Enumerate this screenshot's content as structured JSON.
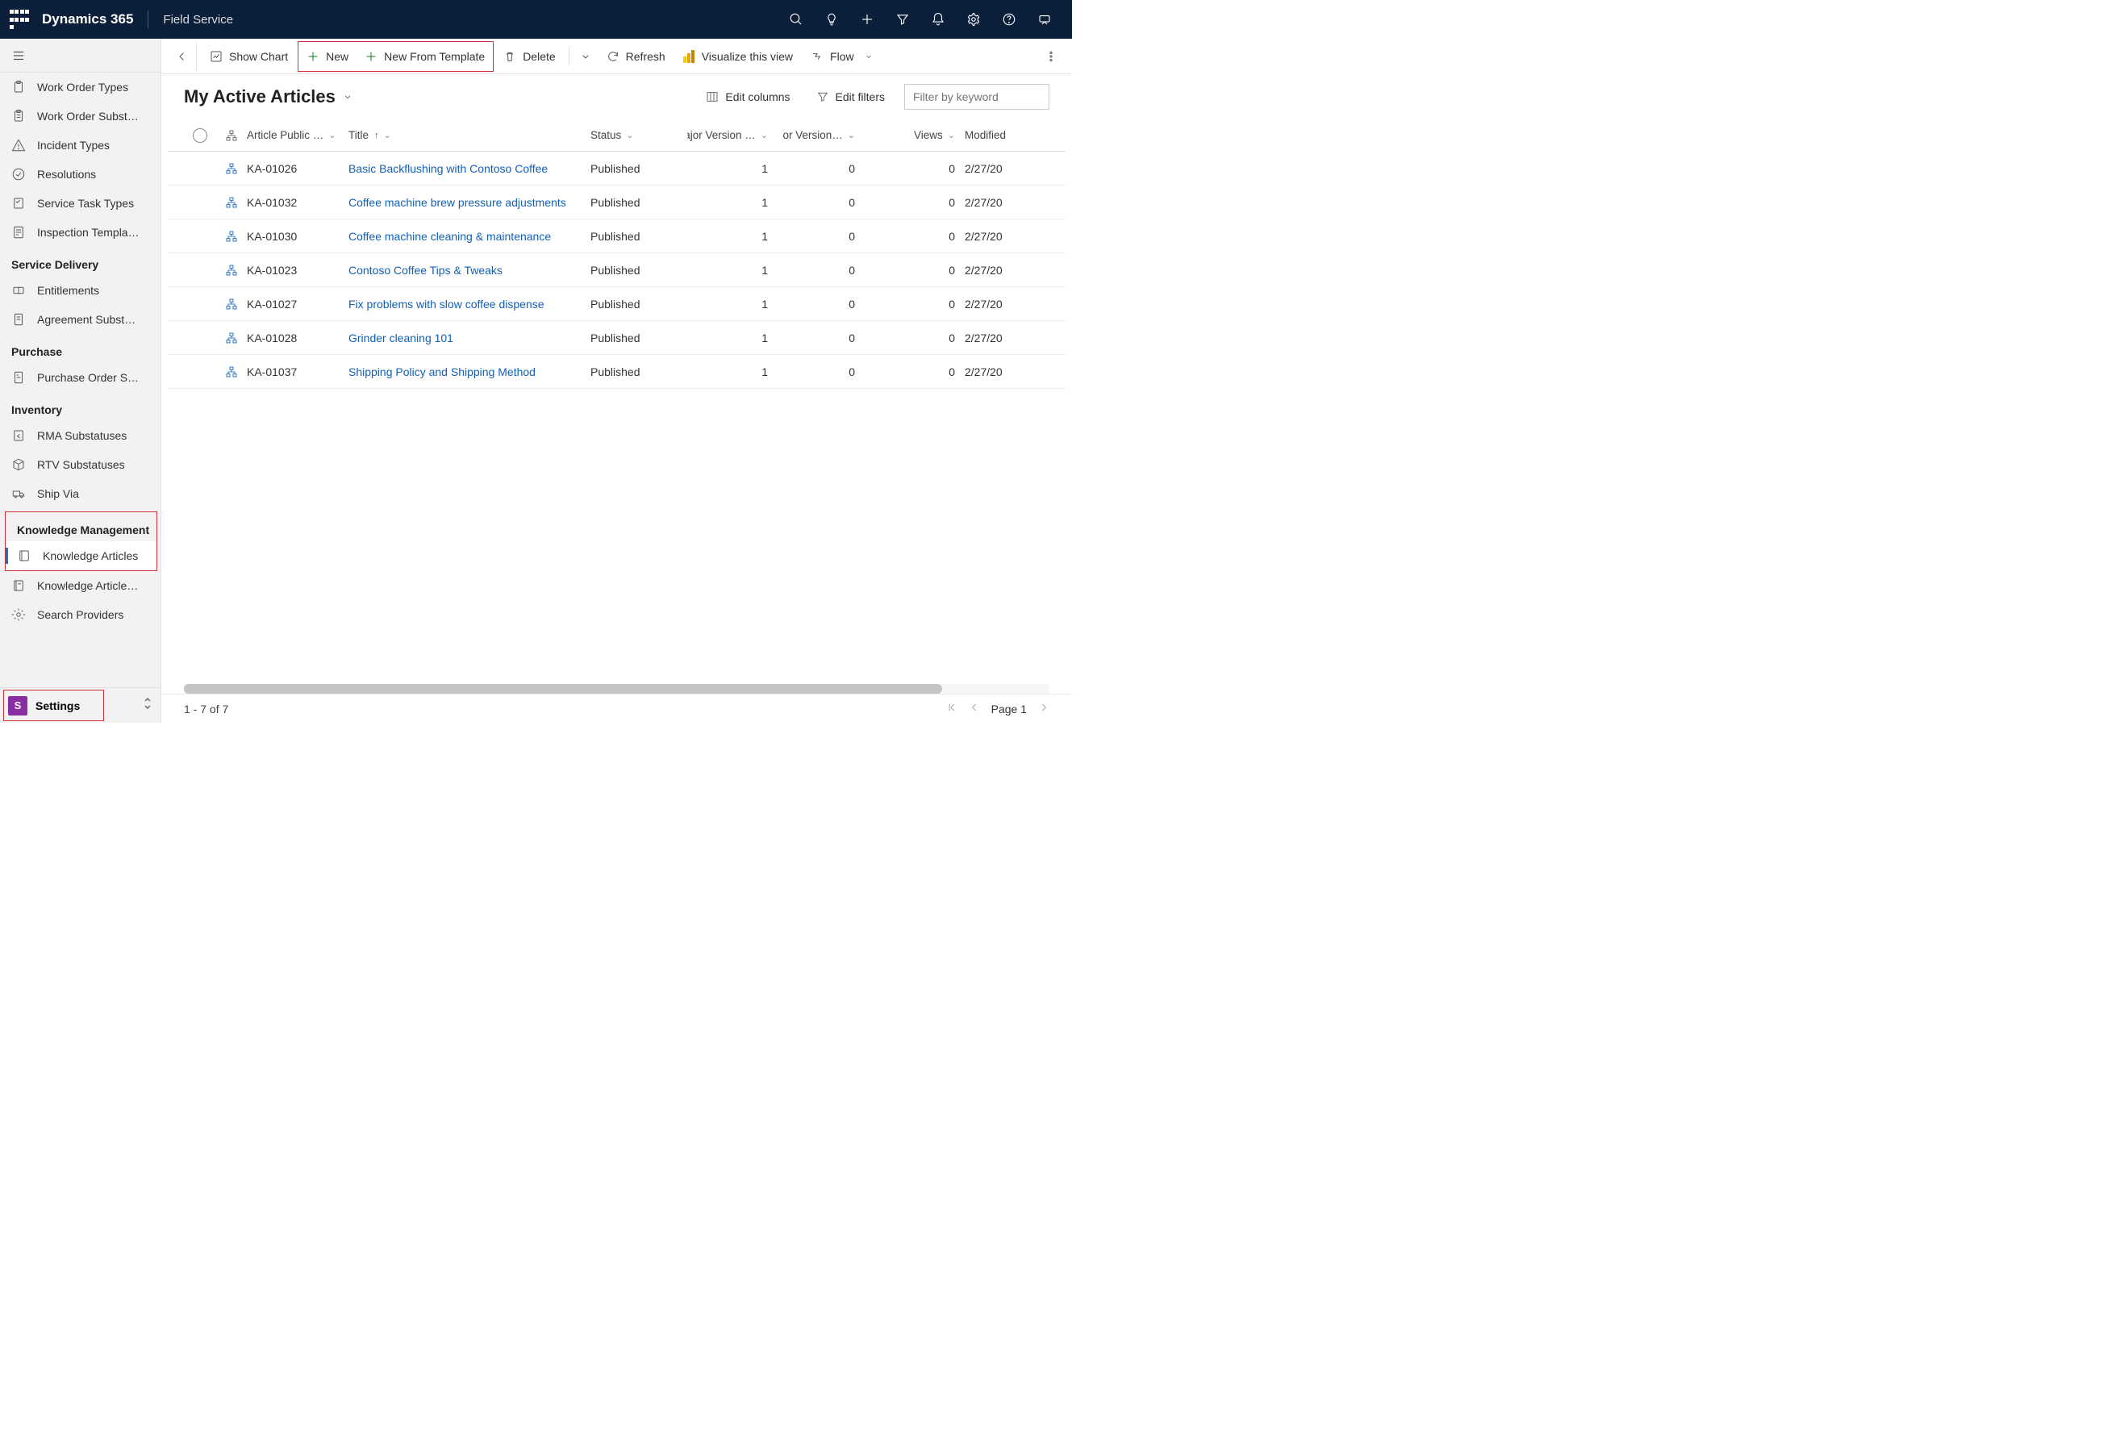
{
  "header": {
    "brand": "Dynamics 365",
    "module": "Field Service"
  },
  "nav": {
    "hamburger": "menu",
    "groups": [
      {
        "items": [
          {
            "label": "Work Order Types",
            "icon": "clipboard"
          },
          {
            "label": "Work Order Subst…",
            "icon": "clipboard-list"
          },
          {
            "label": "Incident Types",
            "icon": "warning"
          },
          {
            "label": "Resolutions",
            "icon": "check-circle"
          },
          {
            "label": "Service Task Types",
            "icon": "task"
          },
          {
            "label": "Inspection Templa…",
            "icon": "form"
          }
        ]
      },
      {
        "title": "Service Delivery",
        "items": [
          {
            "label": "Entitlements",
            "icon": "ticket"
          },
          {
            "label": "Agreement Subst…",
            "icon": "doc"
          }
        ]
      },
      {
        "title": "Purchase",
        "items": [
          {
            "label": "Purchase Order S…",
            "icon": "cart"
          }
        ]
      },
      {
        "title": "Inventory",
        "items": [
          {
            "label": "RMA Substatuses",
            "icon": "return"
          },
          {
            "label": "RTV Substatuses",
            "icon": "box"
          },
          {
            "label": "Ship Via",
            "icon": "truck"
          }
        ]
      },
      {
        "title": "Knowledge Management",
        "highlighted": true,
        "items": [
          {
            "label": "Knowledge Articles",
            "icon": "book",
            "active": true
          },
          {
            "label": "Knowledge Article…",
            "icon": "book-template"
          },
          {
            "label": "Search Providers",
            "icon": "gear"
          }
        ]
      }
    ],
    "footer": {
      "tile": "S",
      "label": "Settings"
    }
  },
  "commandbar": {
    "show_chart": "Show Chart",
    "new": "New",
    "new_template": "New From Template",
    "delete": "Delete",
    "refresh": "Refresh",
    "visualize": "Visualize this view",
    "flow": "Flow"
  },
  "view": {
    "title": "My Active Articles",
    "edit_columns": "Edit columns",
    "edit_filters": "Edit filters",
    "filter_placeholder": "Filter by keyword"
  },
  "grid": {
    "columns": {
      "public": "Article Public …",
      "title": "Title",
      "status": "Status",
      "major": "Major Version …",
      "minor": "Minor Version…",
      "views": "Views",
      "modified": "Modified"
    },
    "rows": [
      {
        "pub": "KA-01026",
        "title": "Basic Backflushing with Contoso Coffee",
        "status": "Published",
        "major": "1",
        "minor": "0",
        "views": "0",
        "mod": "2/27/20"
      },
      {
        "pub": "KA-01032",
        "title": "Coffee machine brew pressure adjustments",
        "status": "Published",
        "major": "1",
        "minor": "0",
        "views": "0",
        "mod": "2/27/20"
      },
      {
        "pub": "KA-01030",
        "title": "Coffee machine cleaning & maintenance",
        "status": "Published",
        "major": "1",
        "minor": "0",
        "views": "0",
        "mod": "2/27/20"
      },
      {
        "pub": "KA-01023",
        "title": "Contoso Coffee Tips & Tweaks",
        "status": "Published",
        "major": "1",
        "minor": "0",
        "views": "0",
        "mod": "2/27/20"
      },
      {
        "pub": "KA-01027",
        "title": "Fix problems with slow coffee dispense",
        "status": "Published",
        "major": "1",
        "minor": "0",
        "views": "0",
        "mod": "2/27/20"
      },
      {
        "pub": "KA-01028",
        "title": "Grinder cleaning 101",
        "status": "Published",
        "major": "1",
        "minor": "0",
        "views": "0",
        "mod": "2/27/20"
      },
      {
        "pub": "KA-01037",
        "title": "Shipping Policy and Shipping Method",
        "status": "Published",
        "major": "1",
        "minor": "0",
        "views": "0",
        "mod": "2/27/20"
      }
    ]
  },
  "statusbar": {
    "range": "1 - 7 of 7",
    "page": "Page 1"
  }
}
